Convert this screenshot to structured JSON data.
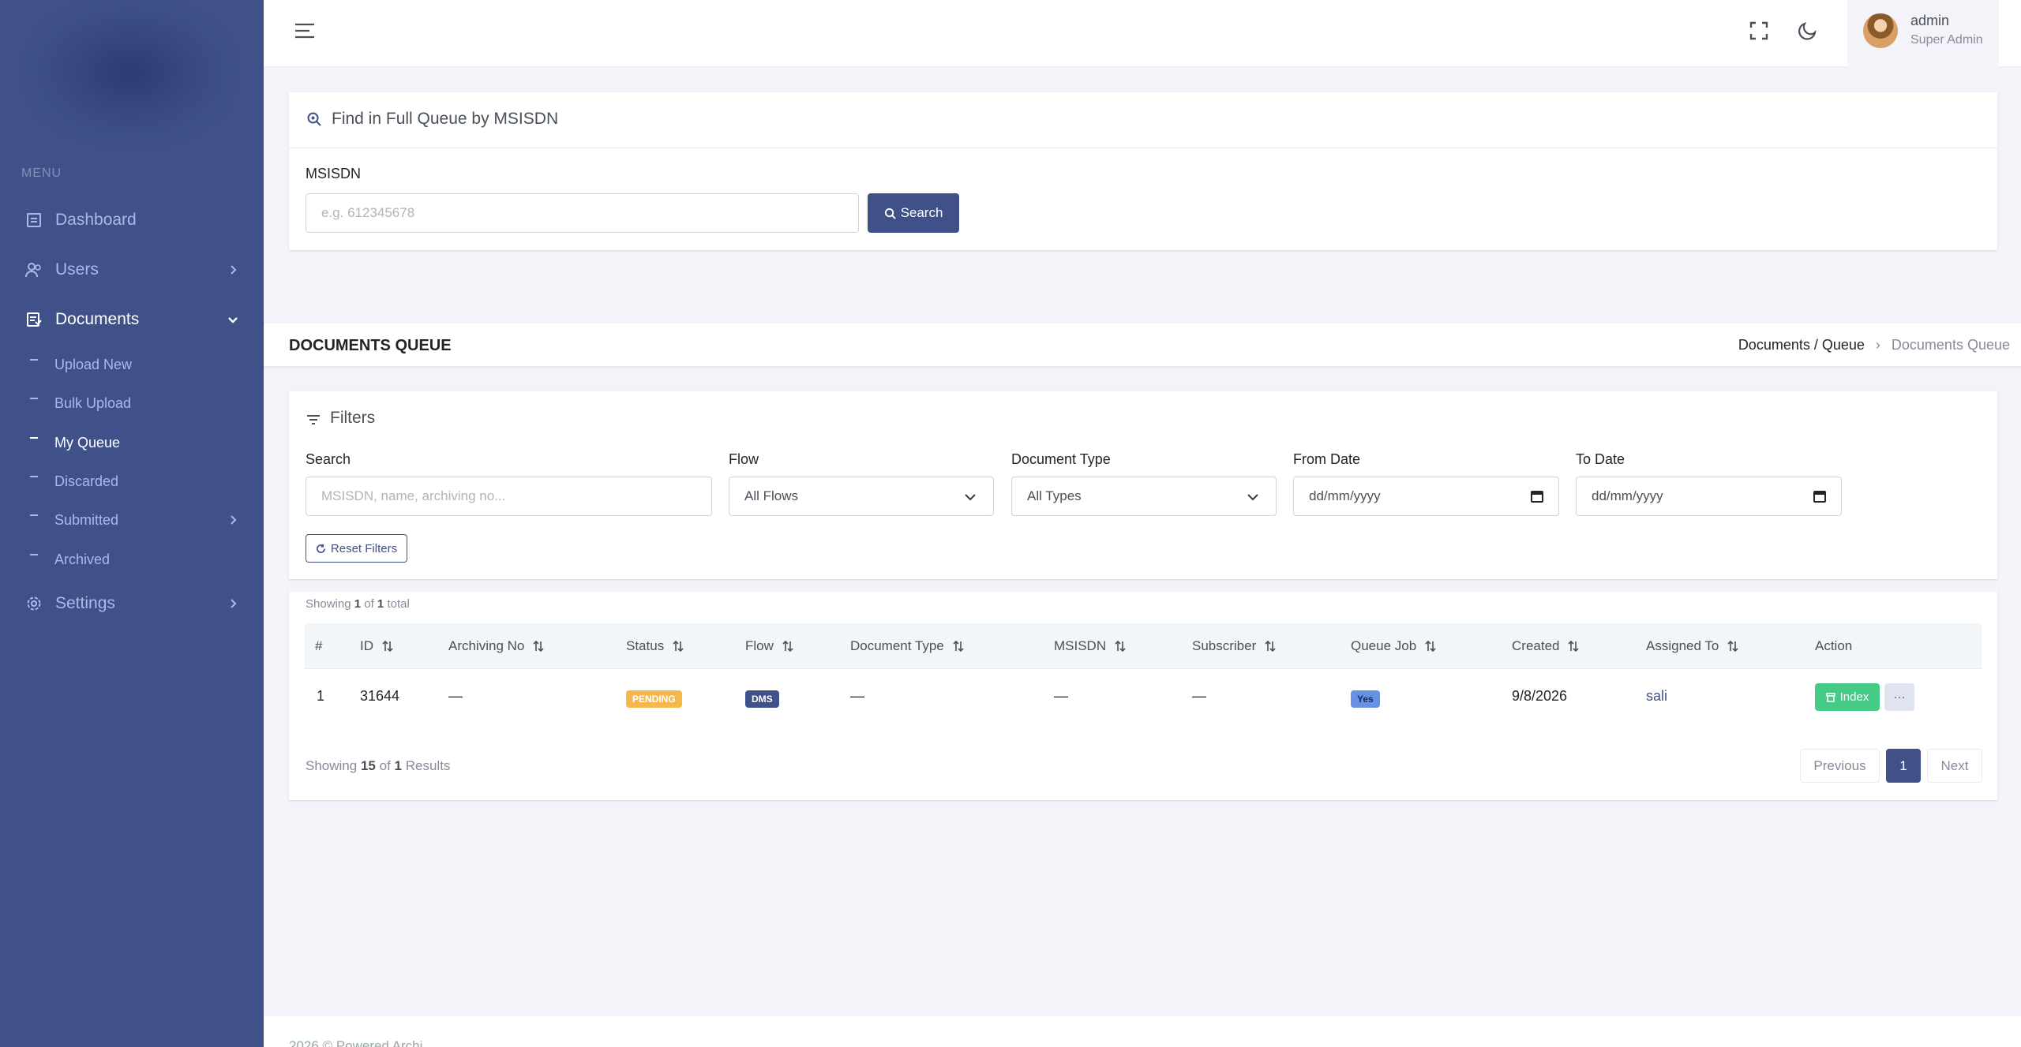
{
  "sidebar": {
    "menu_title": "Menu",
    "items": [
      {
        "label": "Dashboard",
        "icon": "dashboard-icon"
      },
      {
        "label": "Users",
        "icon": "users-icon"
      },
      {
        "label": "Documents",
        "icon": "documents-icon"
      },
      {
        "label": "Settings",
        "icon": "settings-icon"
      }
    ],
    "submenu": [
      {
        "label": "Upload New"
      },
      {
        "label": "Bulk Upload"
      },
      {
        "label": "My Queue"
      },
      {
        "label": "Discarded"
      },
      {
        "label": "Submitted"
      },
      {
        "label": "Archived"
      }
    ]
  },
  "topbar": {
    "user_name": "admin",
    "user_role": "Super Admin"
  },
  "find": {
    "title": "Find in Full Queue by MSISDN",
    "label": "MSISDN",
    "placeholder": "e.g. 612345678",
    "button": "Search"
  },
  "page": {
    "title": "DOCUMENTS QUEUE",
    "breadcrumb_parent": "Documents / Queue",
    "breadcrumb_current": "Documents Queue"
  },
  "filters": {
    "title": "Filters",
    "search_label": "Search",
    "search_placeholder": "MSISDN, name, archiving no...",
    "flow_label": "Flow",
    "flow_value": "All Flows",
    "type_label": "Document Type",
    "type_value": "All Types",
    "from_label": "From Date",
    "from_placeholder": "dd/mm/yyyy",
    "to_label": "To Date",
    "to_placeholder": "dd/mm/yyyy",
    "reset_button": "Reset Filters"
  },
  "summary": {
    "prefix": "Showing",
    "count": "1",
    "of": "of",
    "total": "1",
    "suffix": "total"
  },
  "table": {
    "columns": [
      "#",
      "ID",
      "Archiving No",
      "Status",
      "Flow",
      "Document Type",
      "MSISDN",
      "Subscriber",
      "Queue Job",
      "Created",
      "Assigned To",
      "Action"
    ],
    "rows": [
      {
        "num": "1",
        "id": "31644",
        "archiving_no": "—",
        "status": "PENDING",
        "flow": "DMS",
        "document_type": "—",
        "msisdn": "—",
        "subscriber": "—",
        "queue_job": "Yes",
        "created": "9/8/2026",
        "assigned_to": "sali",
        "action_index": "Index",
        "action_more": "···"
      }
    ]
  },
  "pagination": {
    "showing": "Showing",
    "range": "15",
    "of": "of",
    "total": "1",
    "results": "Results",
    "previous": "Previous",
    "current": "1",
    "next": "Next"
  },
  "footer": {
    "text": "2026 © Powered Archi"
  },
  "colors": {
    "primary": "#405189",
    "pending": "#f7b84b",
    "flow_badge": "#405189",
    "yes_badge": "#6691e7",
    "index_button": "#45cb85"
  }
}
